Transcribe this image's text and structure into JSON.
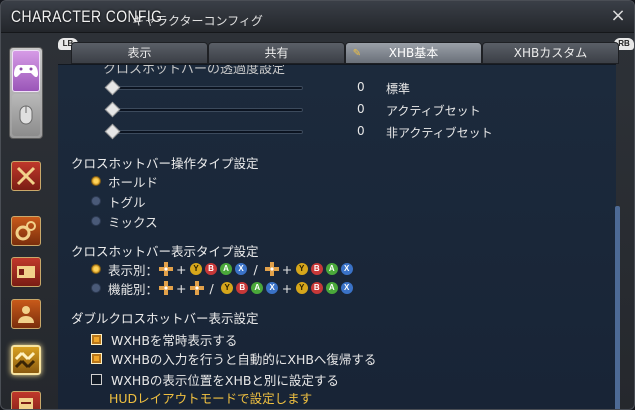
{
  "window": {
    "title_en": "CHARACTER CONFIG",
    "title_jp": "キャラクターコンフィグ",
    "close_label": "×"
  },
  "shoulders": {
    "left": "LB",
    "right": "RB"
  },
  "tabs": [
    {
      "label": "表示",
      "active": false
    },
    {
      "label": "共有",
      "active": false
    },
    {
      "label": "XHB基本",
      "active": true
    },
    {
      "label": "XHBカスタム",
      "active": false
    }
  ],
  "sidebar": {
    "device_selected": "gamepad",
    "categories": [
      "crossed-swords-icon",
      "gears-icon",
      "id-card-icon",
      "person-icon",
      "chain-icon",
      "document-icon"
    ],
    "active_category": 4
  },
  "content": {
    "cut_heading": "クロスホットバーの透過度設定",
    "transparency": [
      {
        "value": "0",
        "label": "標準"
      },
      {
        "value": "0",
        "label": "アクティブセット"
      },
      {
        "value": "0",
        "label": "非アクティブセット"
      }
    ],
    "op_type": {
      "heading": "クロスホットバー操作タイプ設定",
      "options": [
        "ホールド",
        "トグル",
        "ミックス"
      ],
      "selected": 0
    },
    "display_type": {
      "heading": "クロスホットバー表示タイプ設定",
      "opt1_label": "表示別：",
      "opt2_label": "機能別：",
      "selected": 0,
      "slash": "/"
    },
    "double": {
      "heading": "ダブルクロスホットバー表示設定",
      "items": [
        {
          "label": "WXHBを常時表示する",
          "checked": true
        },
        {
          "label": "WXHBの入力を行うと自動的にXHBへ復帰する",
          "checked": true
        },
        {
          "label": "WXHBの表示位置をXHBと別に設定する",
          "checked": false
        }
      ],
      "note": "HUDレイアウトモードで設定します"
    }
  },
  "colors": {
    "accent": "#f0c040",
    "content_bg": "#1c2a3c",
    "radio_on": "#ffd45a"
  }
}
